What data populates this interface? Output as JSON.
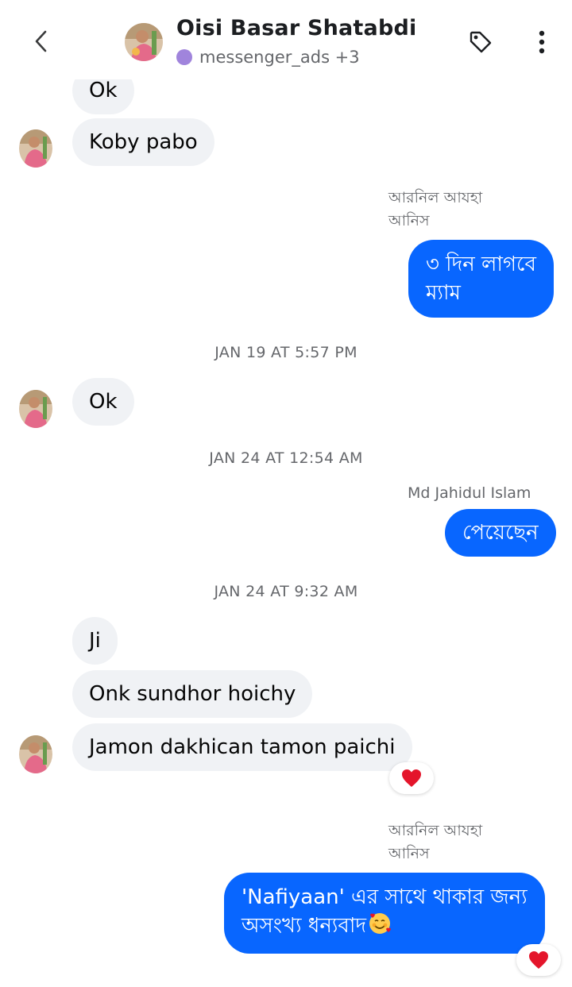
{
  "header": {
    "title": "Oisi Basar Shatabdi",
    "labels": "messenger_ads +3"
  },
  "messages": {
    "m0": "Ok",
    "m1": "Koby pabo",
    "sender1_line1": "আরনিল আযহা",
    "sender1_line2": "আনিস",
    "m2_line1": "৩ দিন লাগবে",
    "m2_line2": "ম্যাম",
    "ts1": "JAN 19 AT 5:57 PM",
    "m3": "Ok",
    "ts2": "JAN 24 AT 12:54 AM",
    "sender2": "Md Jahidul Islam",
    "m4": "পেয়েছেন",
    "ts3": "JAN 24 AT 9:32 AM",
    "m5": "Ji",
    "m6": "Onk sundhor hoichy",
    "m7": "Jamon dakhican tamon paichi",
    "sender3_line1": "আরনিল আযহা",
    "sender3_line2": "আনিস",
    "m8_line1": "'Nafiyaan' এর সাথে থাকার জন্য",
    "m8_line2": "অসংখ্য ধন্যবাদ"
  },
  "icons": {
    "back": "chevron-left-icon",
    "tag": "tag-icon",
    "more": "more-vertical-icon",
    "reaction": "heart-icon",
    "emoji": "smiling-face-with-hearts-icon"
  },
  "colors": {
    "outgoing": "#0866ff",
    "incoming": "#f0f2f5",
    "label_dot": "#a084dc",
    "heart": "#e4152b"
  }
}
